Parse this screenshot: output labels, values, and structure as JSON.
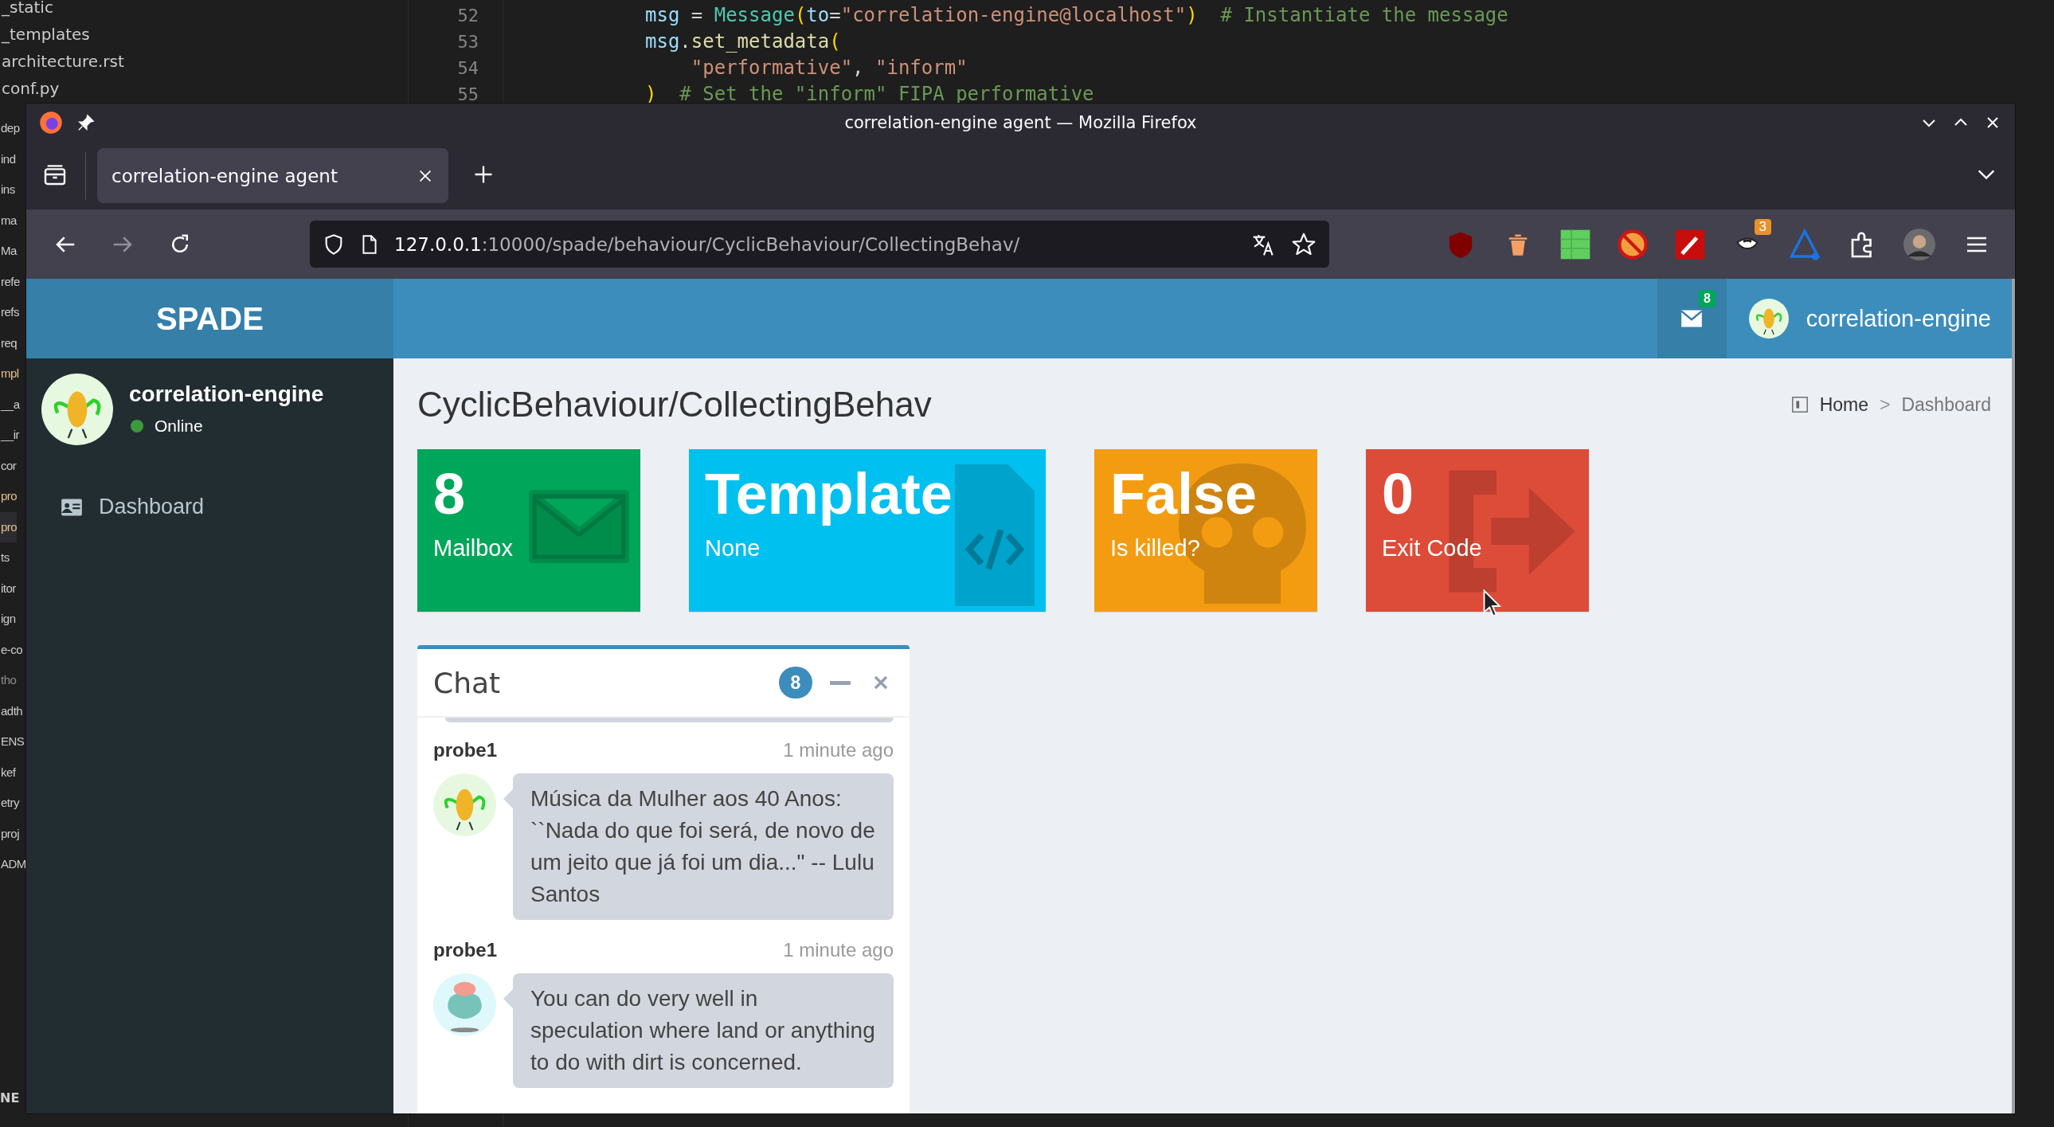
{
  "editor": {
    "files": [
      "_static",
      "_templates",
      "architecture.rst",
      "conf.py"
    ],
    "fragments": [
      {
        "text": "dep",
        "color": "#cccccc",
        "selected": false
      },
      {
        "text": "ind",
        "color": "#cccccc",
        "selected": false
      },
      {
        "text": "ins",
        "color": "#cccccc",
        "selected": false
      },
      {
        "text": "ma",
        "color": "#cccccc",
        "selected": false
      },
      {
        "text": "Ma",
        "color": "#cccccc",
        "selected": false
      },
      {
        "text": "refe",
        "color": "#cccccc",
        "selected": false
      },
      {
        "text": "refs",
        "color": "#cccccc",
        "selected": false
      },
      {
        "text": "req",
        "color": "#cccccc",
        "selected": false
      },
      {
        "text": "mpl",
        "color": "#e2c08d",
        "selected": false
      },
      {
        "text": "__a",
        "color": "#cccccc",
        "selected": false
      },
      {
        "text": "__ir",
        "color": "#cccccc",
        "selected": false
      },
      {
        "text": "cor",
        "color": "#cccccc",
        "selected": false
      },
      {
        "text": "pro",
        "color": "#e2c08d",
        "selected": false
      },
      {
        "text": "pro",
        "color": "#e2c08d",
        "selected": true
      },
      {
        "text": "ts",
        "color": "#cccccc",
        "selected": false
      },
      {
        "text": "itor",
        "color": "#cccccc",
        "selected": false
      },
      {
        "text": "ign",
        "color": "#cccccc",
        "selected": false
      },
      {
        "text": "e-co",
        "color": "#cccccc",
        "selected": false
      },
      {
        "text": "tho",
        "color": "#8c8c8c",
        "selected": false
      },
      {
        "text": "adth",
        "color": "#cccccc",
        "selected": false
      },
      {
        "text": "ENS",
        "color": "#cccccc",
        "selected": false
      },
      {
        "text": "kef",
        "color": "#cccccc",
        "selected": false
      },
      {
        "text": "etry",
        "color": "#cccccc",
        "selected": false
      },
      {
        "text": "proj",
        "color": "#cccccc",
        "selected": false
      },
      {
        "text": "ADM",
        "color": "#cccccc",
        "selected": false
      }
    ],
    "bottom_label": "NE",
    "code_lines": [
      {
        "number": "52",
        "tokens": [
          {
            "text": "msg",
            "kind": "var"
          },
          {
            "text": " = ",
            "kind": "plain"
          },
          {
            "text": "Message",
            "kind": "cls"
          },
          {
            "text": "(",
            "kind": "punc"
          },
          {
            "text": "to",
            "kind": "var"
          },
          {
            "text": "=",
            "kind": "plain"
          },
          {
            "text": "\"correlation-engine@localhost\"",
            "kind": "str"
          },
          {
            "text": ")",
            "kind": "punc"
          },
          {
            "text": "  # Instantiate the message",
            "kind": "comment"
          }
        ]
      },
      {
        "number": "53",
        "tokens": [
          {
            "text": "msg",
            "kind": "var"
          },
          {
            "text": ".",
            "kind": "plain"
          },
          {
            "text": "set_metadata",
            "kind": "func"
          },
          {
            "text": "(",
            "kind": "punc"
          }
        ]
      },
      {
        "number": "54",
        "tokens": [
          {
            "text": "    \"performative\"",
            "kind": "str"
          },
          {
            "text": ", ",
            "kind": "plain"
          },
          {
            "text": "\"inform\"",
            "kind": "str"
          }
        ]
      },
      {
        "number": "55",
        "tokens": [
          {
            "text": ")",
            "kind": "punc"
          },
          {
            "text": "  # Set the \"inform\" FIPA performative",
            "kind": "comment"
          }
        ]
      }
    ]
  },
  "browser": {
    "window_title": "correlation-engine agent — Mozilla Firefox",
    "tabs": [
      {
        "label": "correlation-engine agent",
        "selected": true
      }
    ],
    "back": {
      "disabled": false
    },
    "forward": {
      "disabled": true
    },
    "url": {
      "host": "127.0.0.1",
      "path": ":10000/spade/behaviour/CyclicBehaviour/CollectingBehav/"
    },
    "extension_badge": "3"
  },
  "app": {
    "brand": "SPADE",
    "mail_count": "8",
    "user_name": "correlation-engine",
    "sidebar": {
      "name": "correlation-engine",
      "status": "Online",
      "menu": [
        {
          "label": "Dashboard",
          "selected": false
        }
      ]
    },
    "page_title": "CyclicBehaviour/CollectingBehav",
    "breadcrumb": {
      "home": "Home",
      "separator": ">",
      "current": "Dashboard"
    },
    "info_boxes": [
      {
        "value": "8",
        "label": "Mailbox",
        "color": "#00a65a"
      },
      {
        "value": "Template",
        "label": "None",
        "color": "#00c0ef"
      },
      {
        "value": "False",
        "label": "Is killed?",
        "color": "#f39c12"
      },
      {
        "value": "0",
        "label": "Exit Code",
        "color": "#dd4b39"
      }
    ],
    "chat": {
      "title": "Chat",
      "count": "8",
      "messages": [
        {
          "sender": "probe1",
          "time": "1 minute ago",
          "text": "Música da Mulher aos 40 Anos: ``Nada do que foi será, de novo de um jeito que já foi um dia...\" -- Lulu Santos"
        },
        {
          "sender": "probe1",
          "time": "1 minute ago",
          "text": "You can do very well in speculation where land or anything to do with dirt is concerned."
        }
      ]
    }
  }
}
